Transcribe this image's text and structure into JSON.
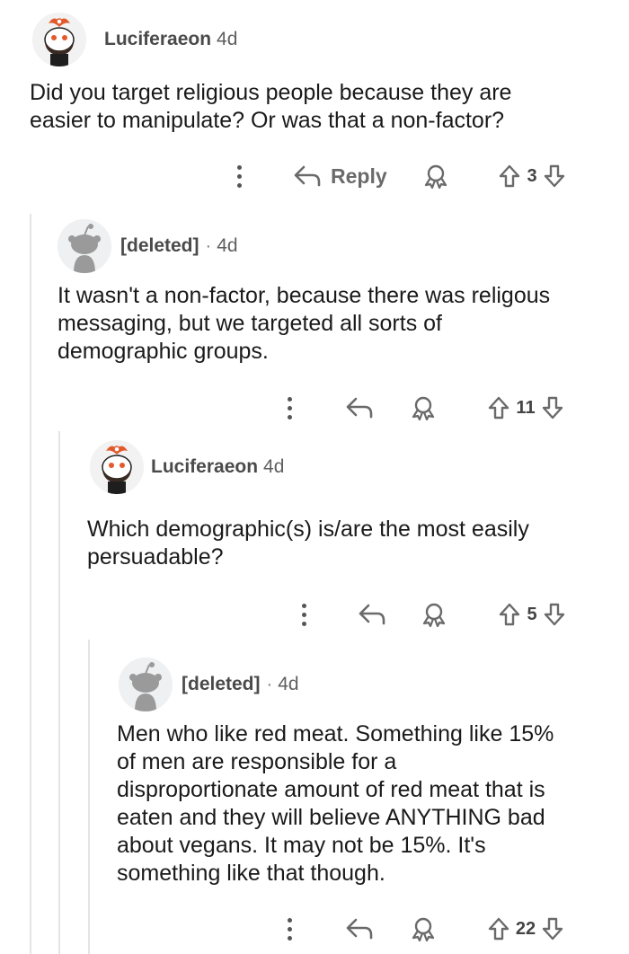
{
  "comments": [
    {
      "author": "Luciferaeon",
      "age": "4d",
      "lines": [
        "Did you target religious people because they are",
        "easier to manipulate? Or was that a non-factor?"
      ],
      "reply_label": "Reply",
      "votes": "3"
    },
    {
      "author": "[deleted]",
      "separator": "·",
      "age": "4d",
      "lines": [
        "It wasn't a non-factor, because there was religous",
        "messaging, but we targeted all sorts of",
        "demographic groups."
      ],
      "votes": "11"
    },
    {
      "author": "Luciferaeon",
      "age": "4d",
      "lines": [
        "Which demographic(s) is/are the most easily",
        "persuadable?"
      ],
      "votes": "5"
    },
    {
      "author": "[deleted]",
      "separator": "·",
      "age": "4d",
      "lines": [
        "Men who like red meat. Something like 15%",
        "of men are responsible for a",
        "disproportionate amount of red meat that is",
        "eaten and they will believe ANYTHING bad",
        "about vegans. It may not be 15%. It's",
        "something like that though."
      ],
      "votes": "22"
    }
  ],
  "icons": {
    "more": "more-options-icon",
    "reply": "reply-arrow-icon",
    "award": "award-icon",
    "upvote": "upvote-arrow-icon",
    "downvote": "downvote-arrow-icon"
  },
  "colors": {
    "text": "#1a1a1b",
    "meta": "#5f5f5f",
    "icon": "#6a6a6a",
    "thread_line": "#e4e4e4",
    "avatar_accent": "#e25a2c"
  }
}
